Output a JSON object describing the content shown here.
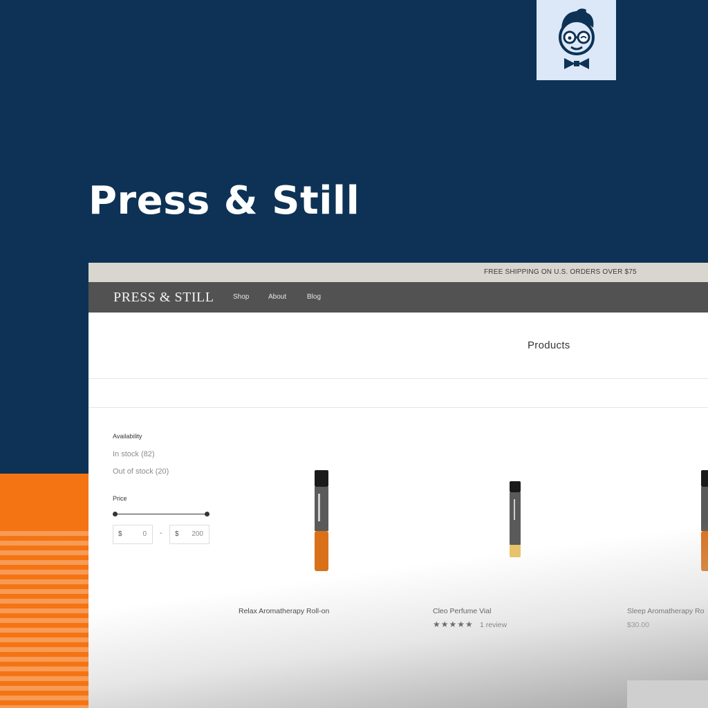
{
  "hero": {
    "title": "Press & Still"
  },
  "site": {
    "announcement": "FREE SHIPPING ON U.S. ORDERS OVER $75",
    "brand": "PRESS & STILL",
    "nav": [
      "Shop",
      "About",
      "Blog"
    ],
    "page_title": "Products"
  },
  "filters": {
    "availability_label": "Availability",
    "in_stock": "In stock (82)",
    "out_of_stock": "Out of stock (20)",
    "price_label": "Price",
    "currency": "$",
    "min_value": "0",
    "max_value": "200",
    "separator": "-"
  },
  "products": [
    {
      "name": "Relax Aromatherapy Roll-on"
    },
    {
      "name": "Cleo Perfume Vial",
      "rating": "★★★★★",
      "reviews": "1 review"
    },
    {
      "name": "Sleep Aromatherapy Ro",
      "price": "$30.00"
    }
  ],
  "colors": {
    "hero_bg": "#0d3256",
    "accent": "#f47414",
    "header_bg": "#525252",
    "announcement_bg": "#d9d5cf"
  }
}
